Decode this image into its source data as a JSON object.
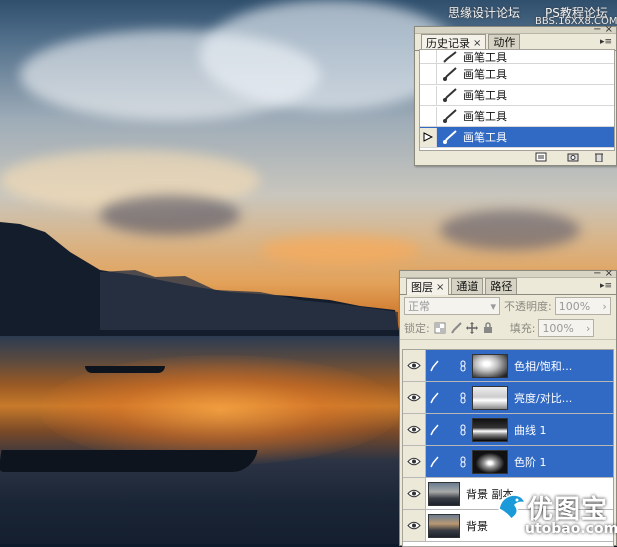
{
  "watermarks": {
    "top_left": "思缘设计论坛",
    "top_right_line1": "PS教程论坛",
    "top_right_line2": "BBS.16XX8.COM",
    "logo_title": "优图宝",
    "logo_domain": "utobao.com"
  },
  "history_panel": {
    "tabs": [
      {
        "label": "历史记录",
        "close": "×",
        "active": true
      },
      {
        "label": "动作",
        "active": false
      }
    ],
    "items": [
      {
        "label": "画笔工具",
        "selected": false
      },
      {
        "label": "画笔工具",
        "selected": false
      },
      {
        "label": "画笔工具",
        "selected": false
      },
      {
        "label": "画笔工具",
        "selected": false
      },
      {
        "label": "画笔工具",
        "selected": true
      }
    ],
    "footer_icons": [
      "new-document-from-state-icon",
      "new-snapshot-icon",
      "delete-state-icon"
    ]
  },
  "layers_panel": {
    "tabs": [
      {
        "label": "图层",
        "close": "×",
        "active": true
      },
      {
        "label": "通道",
        "active": false
      },
      {
        "label": "路径",
        "active": false
      }
    ],
    "blend_mode": "正常",
    "opacity_label": "不透明度:",
    "opacity_value": "100%",
    "lock_label": "锁定:",
    "fill_label": "填充:",
    "fill_value": "100%",
    "layers": [
      {
        "name": "色相/饱和...",
        "type": "adjustment",
        "selected": true
      },
      {
        "name": "亮度/对比...",
        "type": "adjustment",
        "selected": true
      },
      {
        "name": "曲线 1",
        "type": "adjustment",
        "selected": true
      },
      {
        "name": "色阶 1",
        "type": "adjustment",
        "selected": true
      },
      {
        "name": "背景 副本",
        "type": "image",
        "selected": false
      },
      {
        "name": "背景",
        "type": "image",
        "selected": false
      }
    ]
  },
  "colors": {
    "panel_bg": "#ece9d8",
    "selection": "#316ac5"
  }
}
